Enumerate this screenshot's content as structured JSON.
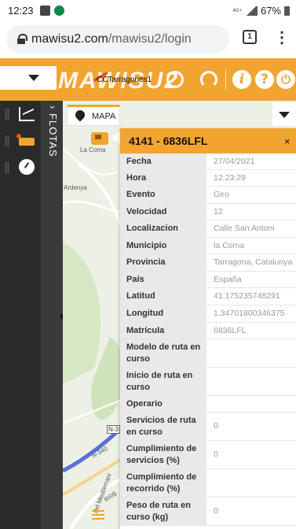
{
  "status_bar": {
    "time": "12:23",
    "network": "4G+",
    "battery": "67%"
  },
  "browser": {
    "url_domain": "mawisu2.com",
    "url_path": "/mawisu2/login",
    "tab_count": "1"
  },
  "header": {
    "logo_text": "MAWISU2",
    "fleet_name": "CCTarragones1",
    "icons": [
      "pulse-icon",
      "gauge-icon",
      "info-icon",
      "help-icon",
      "power-icon"
    ]
  },
  "rail": {
    "items": [
      "chart-icon",
      "truck-icon",
      "gauge-icon"
    ],
    "drawer_label": "FLOTAS"
  },
  "map": {
    "tab_label": "MAPA",
    "labels": [
      "La Coma",
      "Ardenya",
      "N-3",
      "N-340",
      "del Mediterrani",
      "Riog"
    ]
  },
  "popup": {
    "title": "4141 - 6836LFL",
    "close": "×",
    "rows": [
      {
        "key": "Fecha",
        "value": "27/04/2021"
      },
      {
        "key": "Hora",
        "value": "12:23:29"
      },
      {
        "key": "Evento",
        "value": "Giro"
      },
      {
        "key": "Velocidad",
        "value": "12"
      },
      {
        "key": "Localizacion",
        "value": "Calle San Antoni"
      },
      {
        "key": "Municipio",
        "value": "la Coma"
      },
      {
        "key": "Provincia",
        "value": "Tarragona, Catalunya"
      },
      {
        "key": "País",
        "value": "España"
      },
      {
        "key": "Latitud",
        "value": "41.175235748291"
      },
      {
        "key": "Longitud",
        "value": "1.34701800346375"
      },
      {
        "key": "Matrícula",
        "value": "6836LFL"
      },
      {
        "key": "Modelo de ruta en curso",
        "value": ""
      },
      {
        "key": "Inicio de ruta en curso",
        "value": ""
      },
      {
        "key": "Operario",
        "value": ""
      },
      {
        "key": "Servicios de ruta en curso",
        "value": "0"
      },
      {
        "key": "Cumplimiento de servicios (%)",
        "value": "0"
      },
      {
        "key": "Cumplimiento de recorrido (%)",
        "value": ""
      },
      {
        "key": "Peso de ruta en curso (kg)",
        "value": "0"
      }
    ]
  },
  "colors": {
    "accent": "#f2a431",
    "rail": "#2a2a2a",
    "road_blue": "#5a6fd6"
  }
}
